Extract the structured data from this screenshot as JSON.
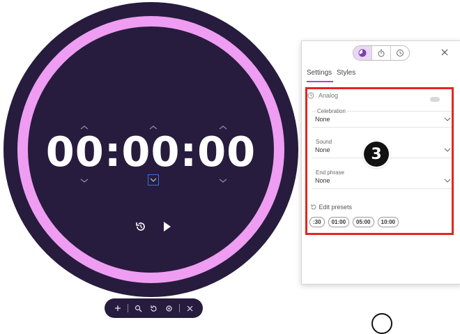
{
  "timer": {
    "display": "00:00:00"
  },
  "toolbar": {
    "buttons": [
      "add-icon",
      "zoom-icon",
      "reset-icon",
      "settings-icon",
      "close-icon"
    ]
  },
  "panel": {
    "modes": [
      "timer-analog-icon",
      "stopwatch-icon",
      "clock-icon"
    ],
    "active_mode": 0,
    "tabs": [
      "Settings",
      "Styles"
    ],
    "active_tab": 0,
    "analog_label": "Analog",
    "fields": [
      {
        "label": "Celebration",
        "value": "None"
      },
      {
        "label": "Sound",
        "value": "None"
      },
      {
        "label": "End phrase",
        "value": "None"
      }
    ],
    "presets_label": "Edit presets",
    "presets": [
      ":30",
      "01:00",
      "05:00",
      "10:00"
    ]
  },
  "annotation": {
    "step": "3",
    "highlight_color": "#e3261d"
  },
  "colors": {
    "dial": "#271c3e",
    "ring": "#ee9df2",
    "accent": "#a44fbf"
  }
}
